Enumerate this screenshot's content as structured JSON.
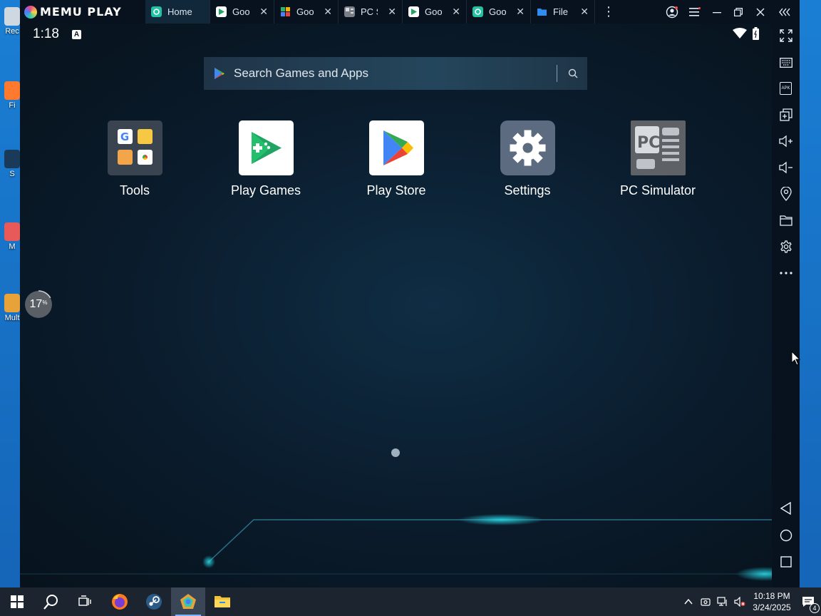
{
  "desktop": {
    "icons": [
      {
        "label": "Rec",
        "color": "#cfd8e0"
      },
      {
        "label": "Fi",
        "color": "#ff7a2f"
      },
      {
        "label": "S",
        "color": "#1a3a5a"
      },
      {
        "label": "M",
        "color": "#e85a5a"
      },
      {
        "label": "Mult",
        "color": "#e8a23a"
      }
    ]
  },
  "titlebar": {
    "brand": "MEMU PLAY",
    "tabs": [
      {
        "label": "Home",
        "icon": "memu-home-icon",
        "color": "#22c3a4",
        "active": true
      },
      {
        "label": "Goo",
        "icon": "play-store-icon",
        "color": "#ffffff",
        "active": false
      },
      {
        "label": "Goo",
        "icon": "puzzle-icon",
        "color": "#33b06b",
        "active": false
      },
      {
        "label": "PC S",
        "icon": "pc-simulator-icon",
        "color": "#7a7f86",
        "active": false
      },
      {
        "label": "Goo",
        "icon": "play-store-icon",
        "color": "#ffffff",
        "active": false
      },
      {
        "label": "Goo",
        "icon": "memu-icon",
        "color": "#22c3a4",
        "active": false
      },
      {
        "label": "File M",
        "icon": "folder-icon",
        "color": "#2f8df0",
        "active": false
      }
    ]
  },
  "android": {
    "status": {
      "time": "1:18",
      "notification": "A"
    },
    "search_placeholder": "Search Games and Apps",
    "apps": [
      {
        "label": "Tools",
        "icon": "tools-folder-icon"
      },
      {
        "label": "Play Games",
        "icon": "play-games-icon"
      },
      {
        "label": "Play Store",
        "icon": "play-store-icon"
      },
      {
        "label": "Settings",
        "icon": "settings-gear-icon"
      },
      {
        "label": "PC Simulator",
        "icon": "pc-simulator-icon"
      }
    ],
    "progress_badge": {
      "value": "17",
      "unit": "%",
      "fraction": 0.17
    }
  },
  "sidebar": {
    "buttons": [
      "fullscreen-icon",
      "keyboard-icon",
      "apk-icon",
      "multi-instance-icon",
      "volume-up-icon",
      "volume-down-icon",
      "location-icon",
      "folder-icon",
      "settings-icon",
      "more-icon"
    ],
    "apk_text": "APK",
    "nav": [
      "back-icon",
      "home-icon",
      "recents-icon"
    ]
  },
  "taskbar": {
    "items": [
      "start-icon",
      "search-icon",
      "task-view-icon",
      "firefox-icon",
      "steam-icon",
      "memu-icon",
      "file-explorer-icon"
    ],
    "time": "10:18 PM",
    "date": "3/24/2025",
    "notification_count": "4"
  },
  "colors": {
    "accent": "#22c3a4",
    "taskbar": "#1c2430",
    "emulator_bg": "#0b1a2a"
  }
}
